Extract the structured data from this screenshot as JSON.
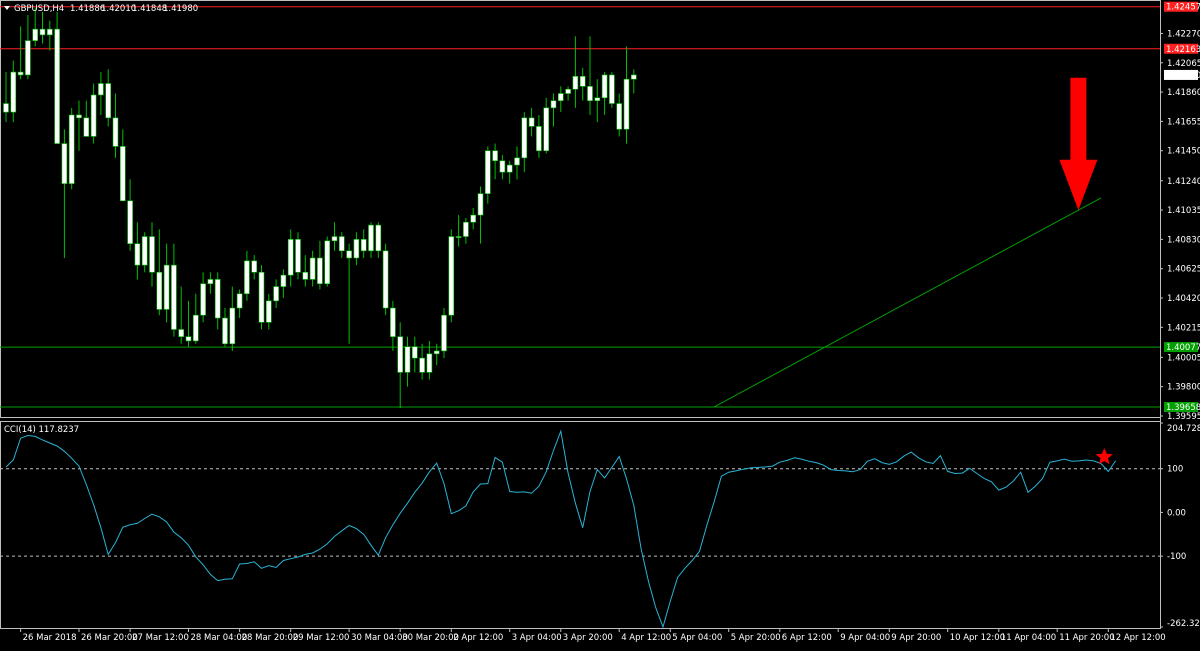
{
  "window": {
    "symbol_header": "GBPUSD,H4",
    "ohlc": [
      "1.41886",
      "1.42010",
      "1.41848",
      "1.41980"
    ]
  },
  "colors": {
    "background": "#000000",
    "frame": "#c0c0c0",
    "candle_up": "#ffffff",
    "candle_down": "#ffffff",
    "wick": "#00c000",
    "resistance": "#ff2020",
    "support": "#00a000",
    "trendline": "#00a000",
    "cci_line": "#2ab4d6",
    "cci_levels": "#c0c0c0",
    "arrow": "#ff0000",
    "star": "#ff0000",
    "price_label_bg": "#ffffff",
    "price_label_text": "#000000"
  },
  "chart_data": [
    {
      "type": "candlestick",
      "title": "GBPUSD,H4",
      "ylim": [
        1.39595,
        1.4249
      ],
      "price_scale_ticks": [
        "1.42270",
        "1.42065",
        "1.41980",
        "1.41860",
        "1.41655",
        "1.41450",
        "1.41240",
        "1.41035",
        "1.40830",
        "1.40625",
        "1.40420",
        "1.40215",
        "1.40005",
        "1.39800",
        "1.39595"
      ],
      "current_price": "1.41980",
      "horizontal_lines": [
        {
          "label": "1.42457",
          "value": 1.42457,
          "kind": "resistance"
        },
        {
          "label": "1.42163",
          "value": 1.42163,
          "kind": "resistance"
        },
        {
          "label": "1.40077",
          "value": 1.40077,
          "kind": "support"
        },
        {
          "label": "1.39658",
          "value": 1.39658,
          "kind": "support"
        }
      ],
      "trendline": {
        "from": {
          "index": 97,
          "value": 1.39658
        },
        "to": {
          "index": 150,
          "value": 1.4112
        }
      },
      "annotation": {
        "type": "arrow-down",
        "start_index": 148,
        "value_from": 1.4196,
        "value_to": 1.41035
      },
      "x_axis_labels": [
        {
          "label": "26 Mar 2018",
          "index": 2
        },
        {
          "label": "26 Mar 20:00",
          "index": 10
        },
        {
          "label": "27 Mar 12:00",
          "index": 17
        },
        {
          "label": "28 Mar 04:00",
          "index": 25
        },
        {
          "label": "28 Mar 20:00",
          "index": 32
        },
        {
          "label": "29 Mar 12:00",
          "index": 39
        },
        {
          "label": "30 Mar 04:00",
          "index": 47
        },
        {
          "label": "30 Mar 20:00",
          "index": 54
        },
        {
          "label": "2 Apr 12:00",
          "index": 61
        },
        {
          "label": "3 Apr 04:00",
          "index": 69
        },
        {
          "label": "3 Apr 20:00",
          "index": 76
        },
        {
          "label": "4 Apr 12:00",
          "index": 84
        },
        {
          "label": "5 Apr 04:00",
          "index": 91
        },
        {
          "label": "5 Apr 20:00",
          "index": 99
        },
        {
          "label": "6 Apr 12:00",
          "index": 106
        },
        {
          "label": "9 Apr 04:00",
          "index": 114
        },
        {
          "label": "9 Apr 20:00",
          "index": 121
        },
        {
          "label": "10 Apr 12:00",
          "index": 129
        },
        {
          "label": "11 Apr 04:00",
          "index": 136
        },
        {
          "label": "11 Apr 20:00",
          "index": 144
        },
        {
          "label": "12 Apr 12:00",
          "index": 151
        }
      ],
      "candles": [
        [
          1.4178,
          1.42,
          1.4165,
          1.4172
        ],
        [
          1.4172,
          1.4208,
          1.4165,
          1.42
        ],
        [
          1.42,
          1.4232,
          1.4195,
          1.4198
        ],
        [
          1.4198,
          1.424,
          1.4195,
          1.4222
        ],
        [
          1.4222,
          1.4245,
          1.4218,
          1.423
        ],
        [
          1.423,
          1.4242,
          1.422,
          1.4226
        ],
        [
          1.4226,
          1.4236,
          1.4215,
          1.423
        ],
        [
          1.423,
          1.4242,
          1.421,
          1.415
        ],
        [
          1.415,
          1.416,
          1.407,
          1.4122
        ],
        [
          1.4122,
          1.4175,
          1.4118,
          1.417
        ],
        [
          1.417,
          1.418,
          1.4145,
          1.4168
        ],
        [
          1.4168,
          1.418,
          1.4155,
          1.4155
        ],
        [
          1.4155,
          1.4192,
          1.415,
          1.4184
        ],
        [
          1.4184,
          1.42,
          1.417,
          1.4192
        ],
        [
          1.4192,
          1.4202,
          1.4162,
          1.4168
        ],
        [
          1.4168,
          1.4185,
          1.414,
          1.4148
        ],
        [
          1.4148,
          1.416,
          1.412,
          1.411
        ],
        [
          1.411,
          1.4125,
          1.4075,
          1.408
        ],
        [
          1.408,
          1.4095,
          1.4055,
          1.4065
        ],
        [
          1.4065,
          1.4088,
          1.406,
          1.4085
        ],
        [
          1.4085,
          1.4095,
          1.405,
          1.406
        ],
        [
          1.406,
          1.409,
          1.403,
          1.4034
        ],
        [
          1.4034,
          1.408,
          1.4025,
          1.4065
        ],
        [
          1.4065,
          1.408,
          1.4015,
          1.402
        ],
        [
          1.402,
          1.405,
          1.401,
          1.4015
        ],
        [
          1.4015,
          1.404,
          1.4008,
          1.4012
        ],
        [
          1.4012,
          1.4045,
          1.401,
          1.403
        ],
        [
          1.403,
          1.406,
          1.4025,
          1.4052
        ],
        [
          1.4052,
          1.406,
          1.4045,
          1.4055
        ],
        [
          1.4055,
          1.406,
          1.402,
          1.4028
        ],
        [
          1.4028,
          1.4035,
          1.4008,
          1.401
        ],
        [
          1.401,
          1.405,
          1.4005,
          1.4035
        ],
        [
          1.4035,
          1.4048,
          1.4028,
          1.4045
        ],
        [
          1.4045,
          1.4075,
          1.404,
          1.4068
        ],
        [
          1.4068,
          1.4072,
          1.4055,
          1.406
        ],
        [
          1.406,
          1.4065,
          1.402,
          1.4025
        ],
        [
          1.4025,
          1.4045,
          1.402,
          1.404
        ],
        [
          1.404,
          1.4055,
          1.4035,
          1.405
        ],
        [
          1.405,
          1.4062,
          1.4042,
          1.4058
        ],
        [
          1.4058,
          1.409,
          1.405,
          1.4083
        ],
        [
          1.4083,
          1.4088,
          1.4055,
          1.406
        ],
        [
          1.406,
          1.4072,
          1.405,
          1.4055
        ],
        [
          1.4055,
          1.4075,
          1.405,
          1.407
        ],
        [
          1.407,
          1.4082,
          1.4048,
          1.4052
        ],
        [
          1.4052,
          1.4085,
          1.405,
          1.4082
        ],
        [
          1.4082,
          1.4095,
          1.4075,
          1.4085
        ],
        [
          1.4085,
          1.4088,
          1.407,
          1.4075
        ],
        [
          1.4075,
          1.408,
          1.401,
          1.407
        ],
        [
          1.407,
          1.4088,
          1.4065,
          1.4083
        ],
        [
          1.4083,
          1.409,
          1.407,
          1.4075
        ],
        [
          1.4075,
          1.4095,
          1.407,
          1.4093
        ],
        [
          1.4093,
          1.4095,
          1.407,
          1.4075
        ],
        [
          1.4075,
          1.408,
          1.403,
          1.4035
        ],
        [
          1.4035,
          1.404,
          1.4005,
          1.4015
        ],
        [
          1.4015,
          1.4025,
          1.3965,
          1.399
        ],
        [
          1.399,
          1.4015,
          1.398,
          1.4008
        ],
        [
          1.4008,
          1.4015,
          1.399,
          1.4
        ],
        [
          1.4,
          1.401,
          1.3985,
          1.399
        ],
        [
          1.399,
          1.4012,
          1.3985,
          1.4003
        ],
        [
          1.4003,
          1.401,
          1.3995,
          1.4005
        ],
        [
          1.4005,
          1.4035,
          1.4,
          1.403
        ],
        [
          1.403,
          1.409,
          1.4025,
          1.4085
        ],
        [
          1.4085,
          1.41,
          1.4078,
          1.4085
        ],
        [
          1.4085,
          1.4098,
          1.408,
          1.4095
        ],
        [
          1.4095,
          1.4105,
          1.409,
          1.41
        ],
        [
          1.41,
          1.412,
          1.408,
          1.4115
        ],
        [
          1.4115,
          1.4148,
          1.4108,
          1.4145
        ],
        [
          1.4145,
          1.415,
          1.4125,
          1.4138
        ],
        [
          1.4138,
          1.4142,
          1.4125,
          1.413
        ],
        [
          1.413,
          1.4138,
          1.4122,
          1.4135
        ],
        [
          1.4135,
          1.4148,
          1.4125,
          1.414
        ],
        [
          1.414,
          1.4172,
          1.413,
          1.4168
        ],
        [
          1.4168,
          1.4175,
          1.4155,
          1.4162
        ],
        [
          1.4162,
          1.417,
          1.414,
          1.4145
        ],
        [
          1.4145,
          1.4182,
          1.4143,
          1.4175
        ],
        [
          1.4175,
          1.4185,
          1.4162,
          1.418
        ],
        [
          1.418,
          1.419,
          1.4172,
          1.4185
        ],
        [
          1.4185,
          1.419,
          1.418,
          1.4188
        ],
        [
          1.4188,
          1.4225,
          1.4175,
          1.4197
        ],
        [
          1.4197,
          1.4203,
          1.418,
          1.419
        ],
        [
          1.419,
          1.4225,
          1.417,
          1.418
        ],
        [
          1.418,
          1.4195,
          1.4165,
          1.4182
        ],
        [
          1.4182,
          1.42,
          1.417,
          1.4198
        ],
        [
          1.4198,
          1.42,
          1.4175,
          1.4178
        ],
        [
          1.4178,
          1.4185,
          1.4155,
          1.416
        ],
        [
          1.416,
          1.4218,
          1.415,
          1.4195
        ],
        [
          1.4195,
          1.4202,
          1.4185,
          1.4198
        ]
      ]
    },
    {
      "type": "line",
      "title": "CCI(14) 117.8237",
      "indicator": "CCI(14)",
      "current_value": "117.8237",
      "ylim": [
        -262.3283,
        204.7287
      ],
      "y_ticks": [
        "204.7287",
        "100",
        "0.00",
        "-100",
        "-262.3283"
      ],
      "levels": [
        100,
        -100
      ],
      "marker": {
        "type": "star",
        "index": 151,
        "value": 117.8237
      },
      "series": [
        {
          "values": [
            104,
            120,
            170,
            176,
            174,
            166,
            159,
            152,
            140,
            124,
            106,
            64,
            18,
            -35,
            -96,
            -69,
            -34,
            -28,
            -25,
            -14,
            -4,
            -10,
            -22,
            -45,
            -58,
            -75,
            -102,
            -120,
            -142,
            -156,
            -153,
            -152,
            -118,
            -117,
            -113,
            -128,
            -122,
            -126,
            -110,
            -106,
            -102,
            -96,
            -93,
            -84,
            -72,
            -55,
            -42,
            -30,
            -37,
            -50,
            -75,
            -98,
            -58,
            -28,
            -2,
            21,
            46,
            67,
            93,
            113,
            66,
            -3,
            4,
            15,
            47,
            65,
            66,
            126,
            115,
            48,
            46,
            47,
            44,
            60,
            93,
            142,
            186,
            90,
            21,
            -35,
            48,
            98,
            79,
            103,
            128,
            77,
            16,
            -83,
            -157,
            -218,
            -262,
            -203,
            -149,
            -128,
            -110,
            -89,
            -30,
            24,
            83,
            92,
            95,
            99,
            102,
            103,
            104,
            106,
            115,
            119,
            125,
            122,
            117,
            114,
            108,
            98,
            96,
            95,
            93,
            98,
            117,
            123,
            114,
            110,
            116,
            129,
            138,
            125,
            116,
            112,
            130,
            94,
            89,
            90,
            101,
            89,
            78,
            70,
            51,
            58,
            72,
            92,
            46,
            60,
            78,
            115,
            118,
            122,
            117,
            118,
            120,
            118,
            112,
            94,
            118
          ]
        }
      ]
    }
  ]
}
